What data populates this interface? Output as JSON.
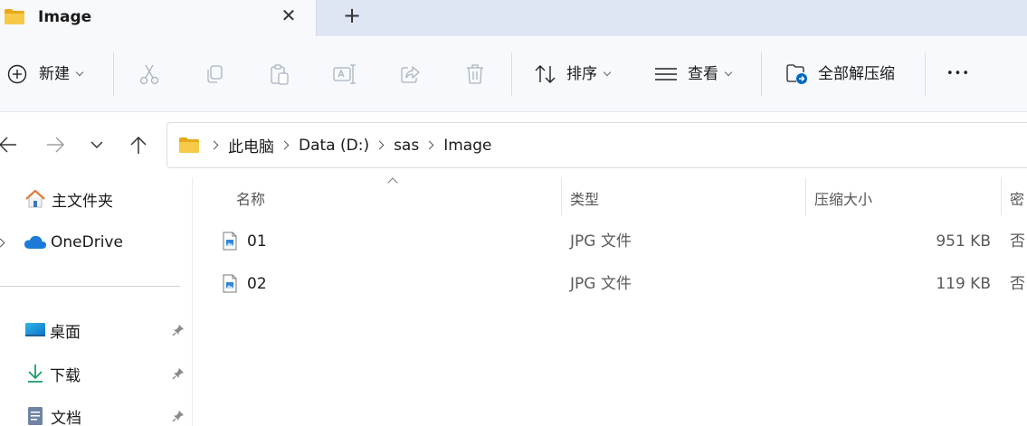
{
  "tab": {
    "title": "Image",
    "close_glyph": "✕",
    "new_tab_glyph": "+"
  },
  "toolbar": {
    "new_label": "新建",
    "sort_label": "排序",
    "view_label": "查看",
    "extract_all_label": "全部解压缩",
    "more_glyph": "•••",
    "icons": [
      "plus-circle-icon",
      "cut-icon",
      "copy-icon",
      "paste-icon",
      "rename-icon",
      "share-icon",
      "delete-icon",
      "sort-icon",
      "view-icon",
      "extract-icon",
      "more-icon"
    ]
  },
  "navigation": {
    "back_icon": "arrow-left-icon",
    "forward_icon": "arrow-right-icon",
    "recent_icon": "chevron-down-icon",
    "up_icon": "arrow-up-icon"
  },
  "breadcrumb": {
    "items": [
      "此电脑",
      "Data (D:)",
      "sas",
      "Image"
    ]
  },
  "sidebar": {
    "items": [
      {
        "label": "主文件夹",
        "icon": "home-icon"
      },
      {
        "label": "OneDrive",
        "icon": "cloud-icon"
      },
      {
        "label": "桌面",
        "icon": "desktop-icon",
        "pinned": true
      },
      {
        "label": "下载",
        "icon": "download-icon",
        "pinned": true
      },
      {
        "label": "文档",
        "icon": "document-icon",
        "pinned": true
      }
    ]
  },
  "filelist": {
    "columns": [
      "名称",
      "类型",
      "压缩大小",
      "密"
    ],
    "rows": [
      {
        "name": "01",
        "type": "JPG 文件",
        "size": "951 KB",
        "protected": "否"
      },
      {
        "name": "02",
        "type": "JPG 文件",
        "size": "119 KB",
        "protected": "否"
      }
    ]
  },
  "colors": {
    "folder": "#f4c444",
    "accent": "#0067c0",
    "onedrive": "#1c7bd8",
    "download": "#1f9d6b"
  }
}
